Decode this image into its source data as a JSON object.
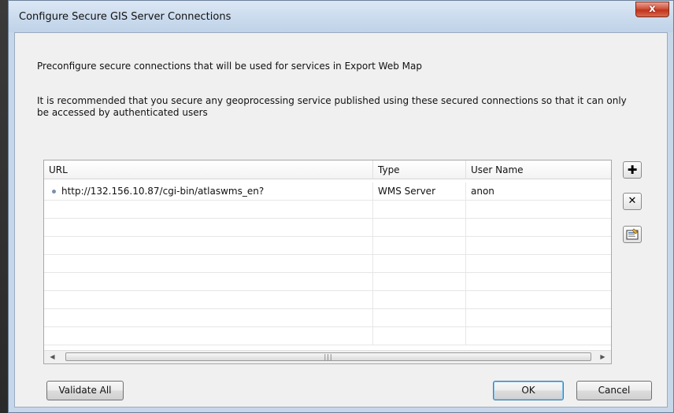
{
  "window": {
    "title": "Configure Secure GIS Server Connections",
    "close_glyph": "x"
  },
  "intro_text": "Preconfigure secure connections that will be used for services in Export Web Map",
  "recommend_text": "It is recommended that you secure any geoprocessing service published using these secured connections so that it can only be accessed by authenticated users",
  "table": {
    "columns": [
      "URL",
      "Type",
      "User Name"
    ],
    "rows": [
      {
        "url": "http://132.156.10.87/cgi-bin/atlaswms_en?",
        "type": "WMS Server",
        "user": "anon"
      }
    ]
  },
  "side_buttons": {
    "add_glyph": "✚",
    "remove_glyph": "✕"
  },
  "buttons": {
    "validate_all": "Validate All",
    "ok": "OK",
    "cancel": "Cancel"
  },
  "icons": {
    "add": "add-icon",
    "remove": "remove-icon",
    "edit": "edit-connection-icon"
  },
  "colors": {
    "title_bar": "#c9daed",
    "close_button": "#c0331c",
    "default_button_border": "#3c7fb1"
  }
}
